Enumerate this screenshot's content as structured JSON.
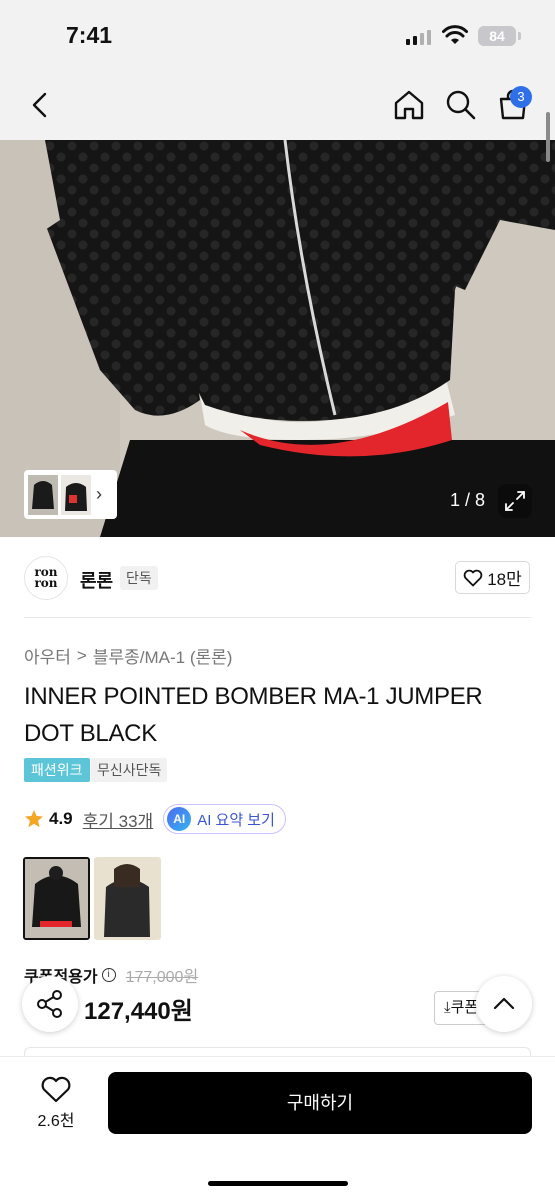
{
  "status_bar": {
    "time": "7:41",
    "battery": "84"
  },
  "nav": {
    "back_icon": "chevron-left-icon",
    "home_icon": "home-icon",
    "search_icon": "search-icon",
    "cart_icon": "bag-icon",
    "cart_count": "3"
  },
  "gallery": {
    "counter": "1 / 8",
    "expand_icon": "expand-icon"
  },
  "brand": {
    "logo_text_top": "ron",
    "logo_text_bottom": "ron",
    "name": "론론",
    "tag": "단독",
    "likes": "18만"
  },
  "breadcrumb": {
    "category": "아우터",
    "separator": ">",
    "subcategory": "블루종/MA-1 (론론)"
  },
  "product": {
    "title": "INNER POINTED BOMBER MA-1 JUMPER DOT BLACK",
    "badges": [
      "패션위크",
      "무신사단독"
    ]
  },
  "rating": {
    "value": "4.9",
    "reviews": "후기 33개",
    "ai_label": "AI",
    "ai_button": "AI 요약 보기"
  },
  "price": {
    "label": "쿠폰적용가",
    "info": "i",
    "original": "177,000원",
    "sale": "127,440원",
    "coupon_button": "⤓쿠폰"
  },
  "bottom": {
    "wish_count": "2.6천",
    "buy_button": "구매하기"
  },
  "colors": {
    "accent_blue": "#2f6fe8",
    "badge_teal": "#5cc6d8",
    "ai_blue": "#3a56d4"
  }
}
